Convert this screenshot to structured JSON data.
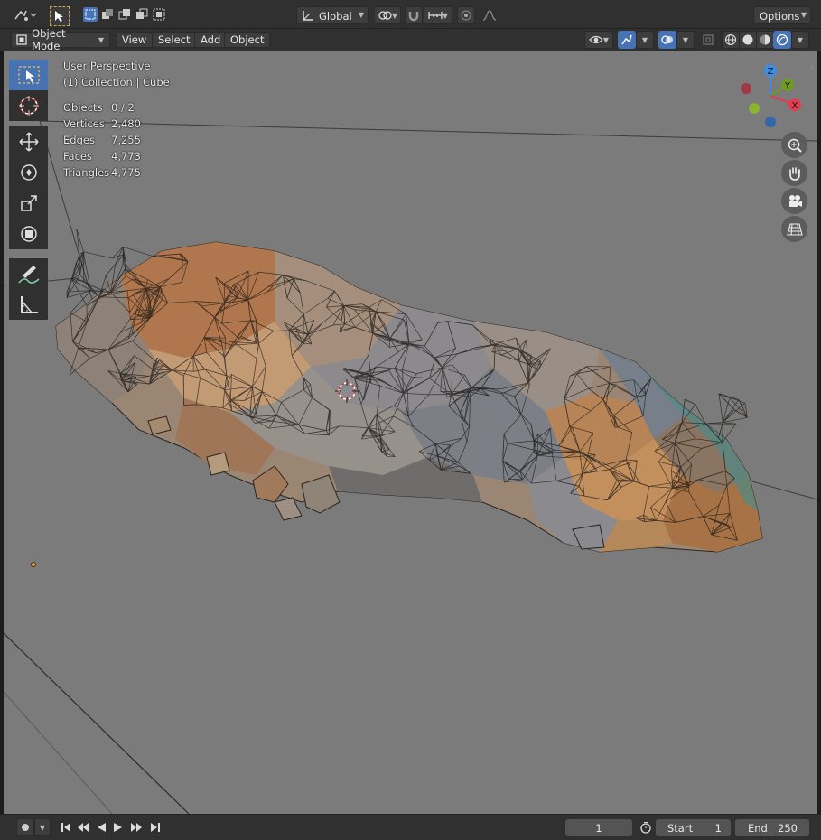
{
  "header": {
    "orientation": "Global",
    "options": "Options"
  },
  "menu": {
    "mode": "Object Mode",
    "view": "View",
    "select": "Select",
    "add": "Add",
    "object": "Object"
  },
  "overlay": {
    "perspective": "User Perspective",
    "collection": "(1) Collection | Cube",
    "stats": [
      {
        "label": "Objects",
        "value": "0 / 2"
      },
      {
        "label": "Vertices",
        "value": "2,480"
      },
      {
        "label": "Edges",
        "value": "7,255"
      },
      {
        "label": "Faces",
        "value": "4,773"
      },
      {
        "label": "Triangles",
        "value": "4,775"
      }
    ]
  },
  "gizmo": {
    "z": "Z",
    "y": "Y",
    "x": "X"
  },
  "timeline": {
    "current_frame": "1",
    "start_label": "Start",
    "start_value": "1",
    "end_label": "End",
    "end_value": "250"
  },
  "colors": {
    "accent": "#4772b3",
    "viewport_bg": "#7b7b7b",
    "panel_bg": "#303030",
    "axis_x": "#e43b4f",
    "axis_y": "#6e9c23",
    "axis_z": "#3b8ee4"
  }
}
